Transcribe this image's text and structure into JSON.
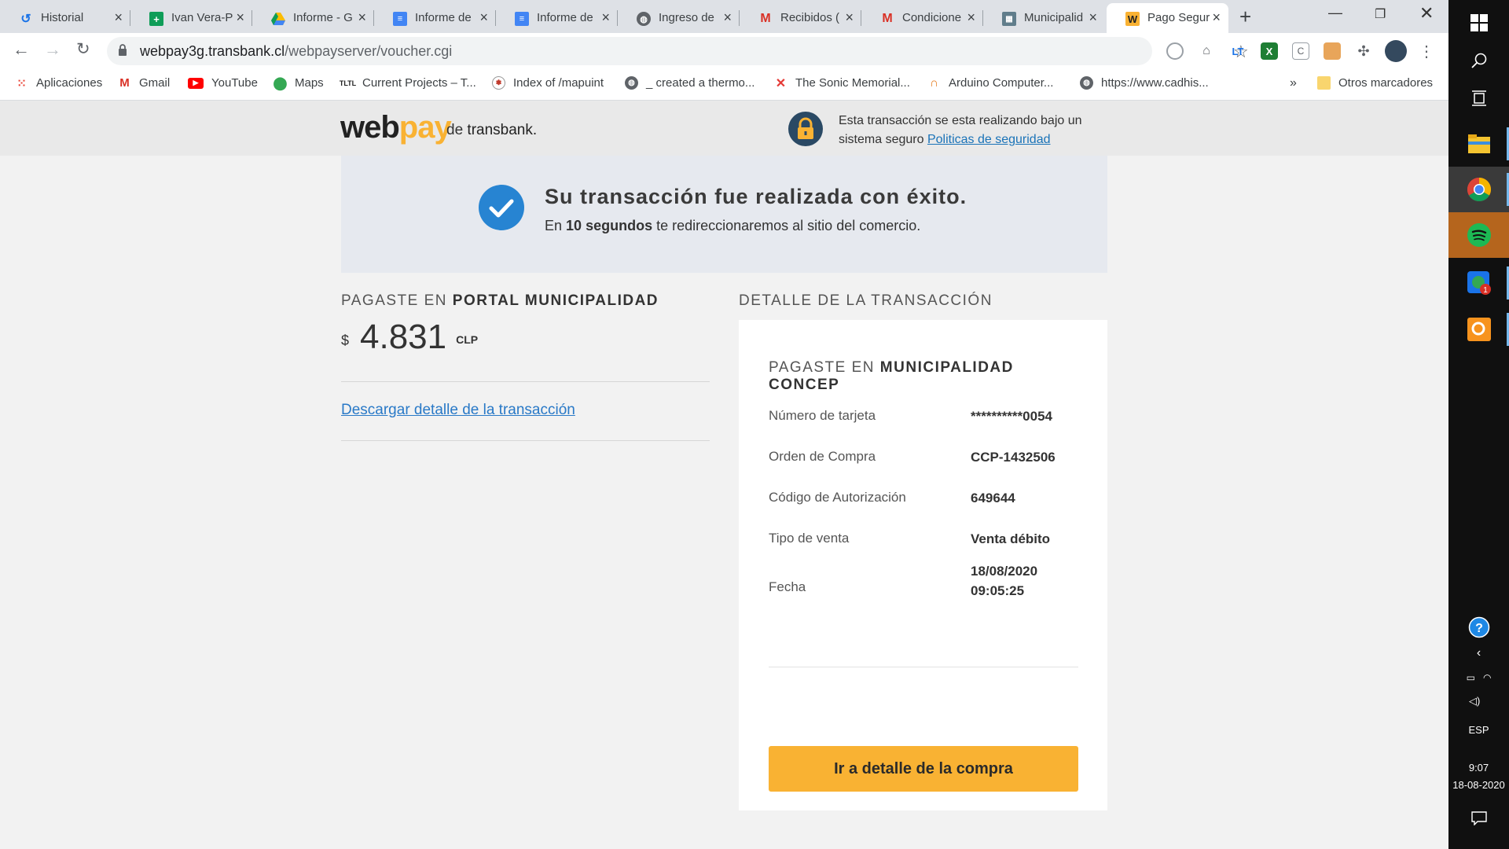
{
  "browser": {
    "tabs": [
      {
        "label": "Historial",
        "favicon": "history-icon",
        "color": "#1a73e8"
      },
      {
        "label": "Ivan Vera-P",
        "favicon": "sheets-icon",
        "color": "#0f9d58"
      },
      {
        "label": "Informe - G",
        "favicon": "drive-icon",
        "color": "#fbbc04"
      },
      {
        "label": "Informe de",
        "favicon": "docs-icon",
        "color": "#4285f4"
      },
      {
        "label": "Informe de",
        "favicon": "docs-icon",
        "color": "#4285f4"
      },
      {
        "label": "Ingreso de",
        "favicon": "globe-icon",
        "color": "#5f6368"
      },
      {
        "label": "Recibidos (",
        "favicon": "gmail-icon",
        "color": "#d93025"
      },
      {
        "label": "Condicione",
        "favicon": "gmail-icon",
        "color": "#d93025"
      },
      {
        "label": "Municipalid",
        "favicon": "municipal-icon",
        "color": "#607d8b"
      },
      {
        "label": "Pago Segur",
        "favicon": "webpay-icon",
        "color": "#f9b233"
      }
    ],
    "url_host": "webpay3g.transbank.cl",
    "url_path": "/webpayserver/voucher.cgi",
    "bookmarks": [
      {
        "label": "Aplicaciones",
        "icon": "apps-grid-icon"
      },
      {
        "label": "Gmail",
        "icon": "gmail-icon"
      },
      {
        "label": "YouTube",
        "icon": "youtube-icon"
      },
      {
        "label": "Maps",
        "icon": "maps-pin-icon"
      },
      {
        "label": "Current Projects – T...",
        "icon": "tltl-icon"
      },
      {
        "label": "Index of /mapuint",
        "icon": "site-icon"
      },
      {
        "label": "_ created a thermo...",
        "icon": "globe-icon"
      },
      {
        "label": "The Sonic Memorial...",
        "icon": "sonic-icon"
      },
      {
        "label": "Arduino Computer...",
        "icon": "arduino-icon"
      },
      {
        "label": "https://www.cadhis...",
        "icon": "globe-icon"
      }
    ],
    "bookmarks_overflow": "»",
    "other_bookmarks": "Otros marcadores"
  },
  "header": {
    "logo_web": "web",
    "logo_pay": "pay",
    "logo_de": "de",
    "logo_transbank": "transbank.",
    "security_text": "Esta transacción se esta realizando bajo un sistema seguro",
    "security_link": "Politicas de seguridad"
  },
  "banner": {
    "title": "Su transacción fue realizada con éxito.",
    "sub_prefix": "En",
    "sub_bold": "10 segundos",
    "sub_suffix": "te redireccionaremos al sitio del comercio."
  },
  "summary": {
    "paid_prefix": "PAGASTE EN",
    "merchant": "PORTAL MUNICIPALIDAD",
    "currency_symbol": "$",
    "amount": "4.831",
    "currency": "CLP",
    "download_link": "Descargar detalle de la transacción"
  },
  "detail": {
    "heading": "DETALLE DE LA TRANSACCIÓN",
    "paid_prefix": "PAGASTE EN",
    "merchant": "MUNICIPALIDAD CONCEP",
    "rows": [
      {
        "label": "Número de tarjeta",
        "value": "**********0054"
      },
      {
        "label": "Orden de Compra",
        "value": "CCP-1432506"
      },
      {
        "label": "Código de Autorización",
        "value": "649644"
      },
      {
        "label": "Tipo de venta",
        "value": "Venta débito"
      },
      {
        "label": "Fecha",
        "value": "18/08/2020",
        "value2": "09:05:25"
      }
    ],
    "cta": "Ir a detalle de la compra"
  },
  "taskbar": {
    "language": "ESP",
    "time": "9:07",
    "date": "18-08-2020",
    "notification_badge": "1"
  },
  "colors": {
    "accent_yellow": "#f9b233",
    "success_blue": "#2784d2",
    "link_blue": "#2979c7"
  }
}
